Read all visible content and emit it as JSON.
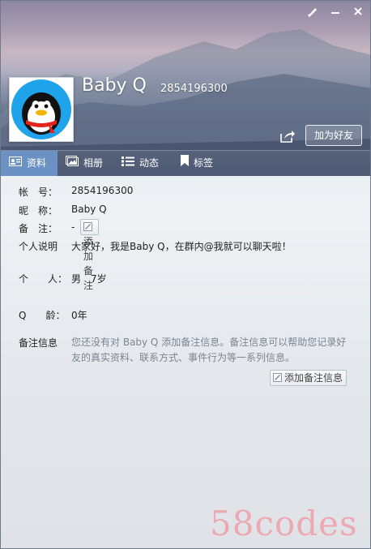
{
  "window": {
    "skin_icon": "brush-icon",
    "minimize_icon": "minimize-icon",
    "close_icon": "close-icon"
  },
  "profile": {
    "nickname": "Baby Q",
    "qq_number": "2854196300",
    "add_friend_label": "加为好友",
    "share_icon": "share-icon"
  },
  "tabs": [
    {
      "label": "资料",
      "icon": "profile-card-icon",
      "active": true
    },
    {
      "label": "相册",
      "icon": "photo-album-icon",
      "active": false
    },
    {
      "label": "动态",
      "icon": "feed-list-icon",
      "active": false
    },
    {
      "label": "标签",
      "icon": "bookmark-icon",
      "active": false
    }
  ],
  "info": {
    "account_label": "帐　号：",
    "account_value": "2854196300",
    "nickname_label": "昵　称：",
    "nickname_value": "Baby Q",
    "remark_label": "备　注：",
    "remark_value": "-",
    "add_remark_button": "添加备注",
    "bio_label": "个人说明",
    "bio_value": "大家好，我是Baby Q，在群内@我就可以聊天啦！",
    "person_label": "个　　人：",
    "person_value": "男　7岁",
    "qage_label": "Q　　龄：",
    "qage_value": "0年",
    "note_info_label": "备注信息",
    "note_info_text": "您还没有对 Baby Q 添加备注信息。备注信息可以帮助您记录好友的真实资料、联系方式、事件行为等一系列信息。",
    "add_note_button": "添加备注信息"
  },
  "watermark": "58codes"
}
